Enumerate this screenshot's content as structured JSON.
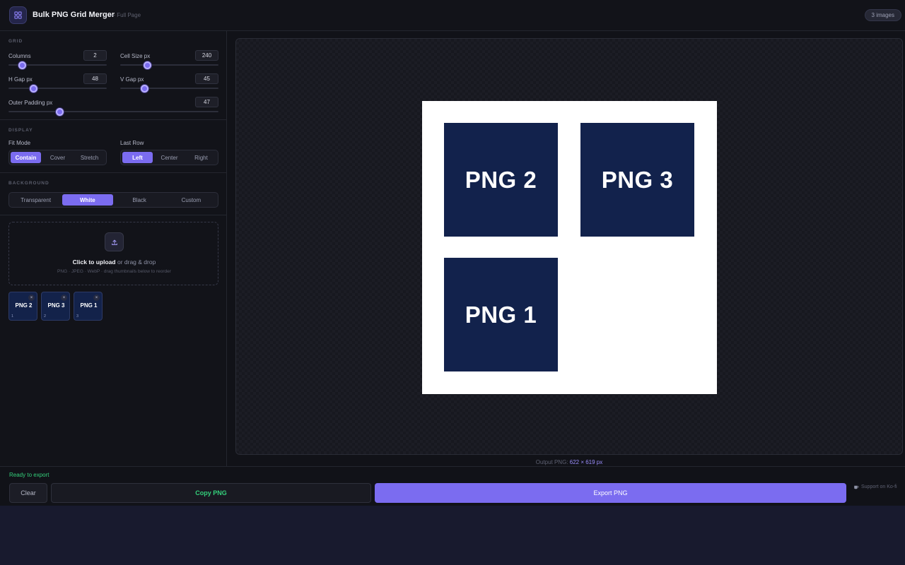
{
  "header": {
    "title": "Bulk PNG Grid Merger",
    "subtitle": "— Full Page",
    "image_count": "3 images"
  },
  "grid": {
    "title": "GRID",
    "columns": {
      "label": "Columns",
      "value": "2"
    },
    "cell_size": {
      "label": "Cell Size px",
      "value": "240"
    },
    "h_gap": {
      "label": "H Gap px",
      "value": "48"
    },
    "v_gap": {
      "label": "V Gap px",
      "value": "45"
    },
    "outer_padding": {
      "label": "Outer Padding px",
      "value": "47"
    }
  },
  "display": {
    "title": "DISPLAY",
    "fit_mode": {
      "label": "Fit Mode",
      "options": [
        "Contain",
        "Cover",
        "Stretch"
      ],
      "selected": "Contain"
    },
    "last_row": {
      "label": "Last Row",
      "options": [
        "Left",
        "Center",
        "Right"
      ],
      "selected": "Left"
    }
  },
  "background": {
    "title": "BACKGROUND",
    "options": [
      "Transparent",
      "White",
      "Black",
      "Custom"
    ],
    "selected": "White"
  },
  "upload": {
    "icon": "upload-icon",
    "cta_bold": "Click to upload",
    "cta_rest": "or drag & drop",
    "hint": "PNG · JPEG · WebP  ·  drag thumbnails below to reorder"
  },
  "thumbnails": [
    {
      "label": "PNG 2",
      "index": "1",
      "remove": "×"
    },
    {
      "label": "PNG 3",
      "index": "2",
      "remove": "×"
    },
    {
      "label": "PNG 1",
      "index": "3",
      "remove": "×"
    }
  ],
  "canvas": {
    "cells": [
      "PNG 2",
      "PNG 3",
      "PNG 1"
    ],
    "output_label": "Output PNG:",
    "output_dims": "622 × 619 px"
  },
  "footer": {
    "status": "Ready to export",
    "clear": "Clear",
    "copy": "Copy PNG",
    "export": "Export PNG",
    "support": "Support on Ko-fi"
  },
  "colors": {
    "accent": "#7b6cf0",
    "success": "#34d07b",
    "tile": "#12224c"
  }
}
